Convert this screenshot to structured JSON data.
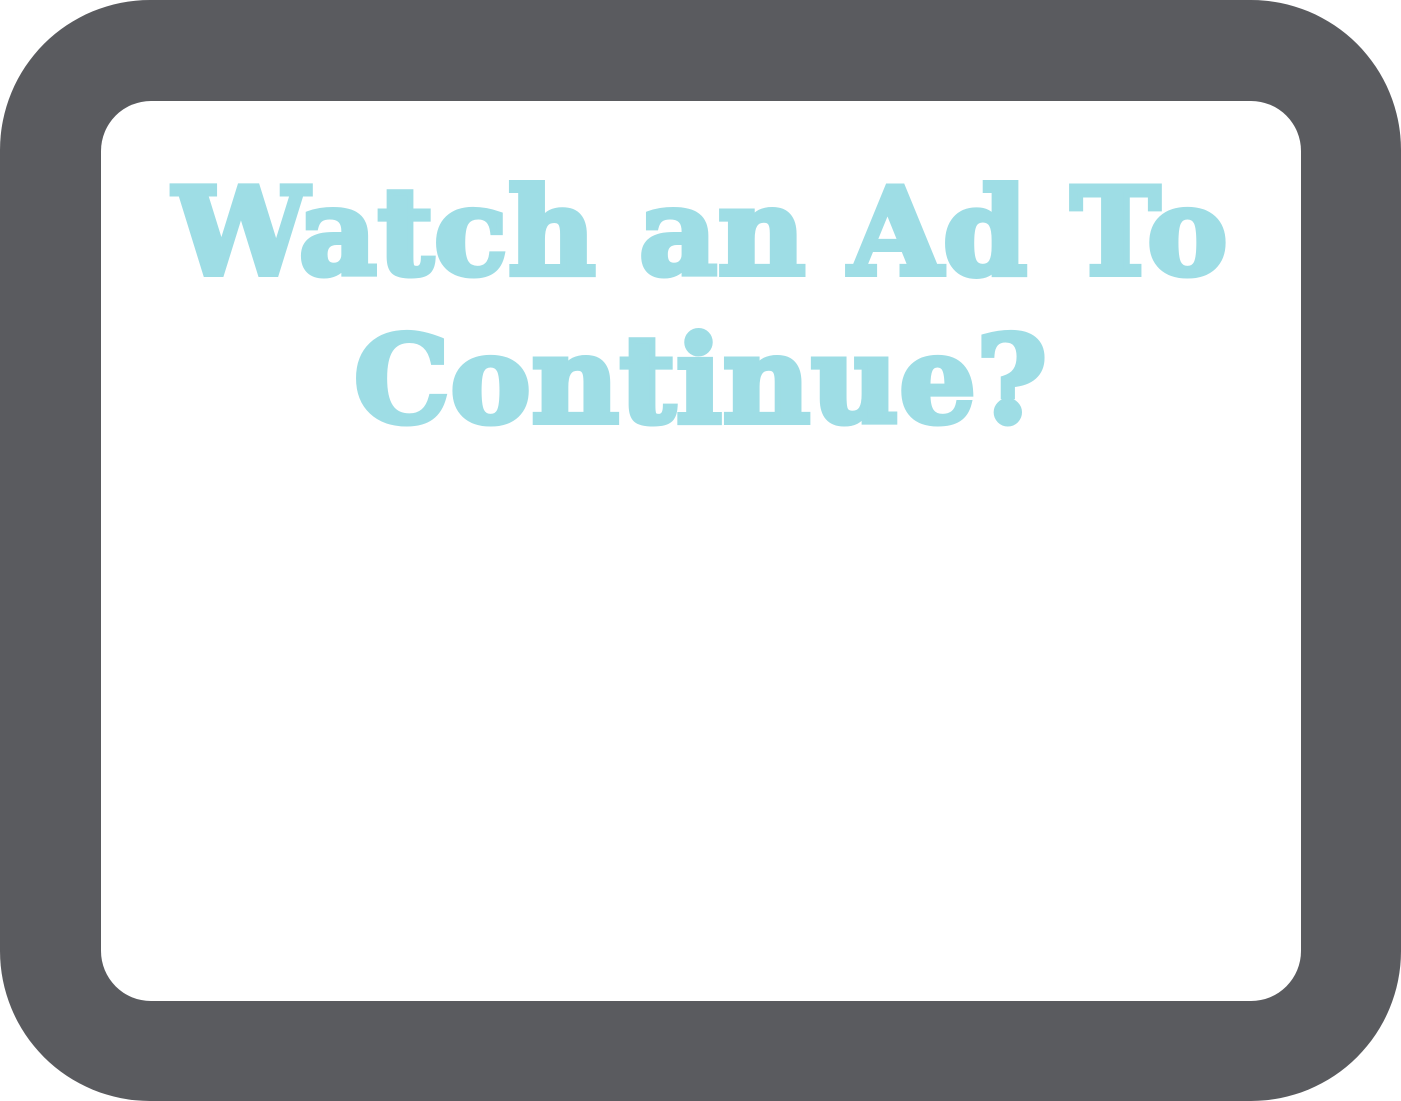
{
  "dialog": {
    "title_line_1": "Watch an Ad To",
    "title_line_2": "Continue?"
  },
  "colors": {
    "frame": "#5a5b5f",
    "panel": "#ffffff",
    "title_text": "#9edde5"
  }
}
